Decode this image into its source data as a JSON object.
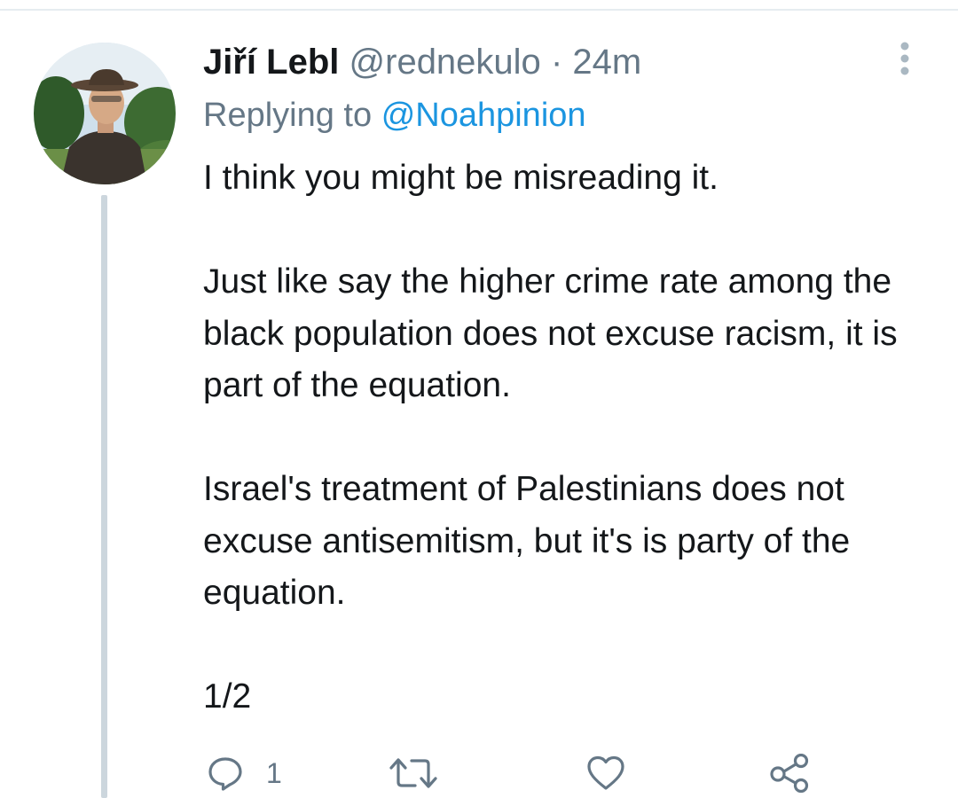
{
  "tweet": {
    "author": {
      "name": "Jiří Lebl",
      "handle": "@rednekulo",
      "separator": "·",
      "time": "24m"
    },
    "replying": {
      "prefix": "Replying to",
      "handle": "@Noahpinion"
    },
    "paragraphs": [
      "I think you might be misreading it.",
      "Just like say the higher crime rate among the black population does not excuse racism, it is part of the equation.",
      "Israel's treatment of Palestinians does not excuse antisemitism, but it's is party of the equation.",
      "1/2"
    ],
    "actions": {
      "reply": {
        "icon": "reply-icon",
        "count": "1"
      },
      "retweet": {
        "icon": "retweet-icon"
      },
      "like": {
        "icon": "heart-icon"
      },
      "share": {
        "icon": "share-icon"
      },
      "more": {
        "icon": "more-vertical-icon"
      }
    }
  },
  "colors": {
    "text": "#14171a",
    "secondary": "#657786",
    "link": "#1b95e0",
    "thread_line": "#ccd6dd",
    "divider": "#e6ecf0"
  }
}
